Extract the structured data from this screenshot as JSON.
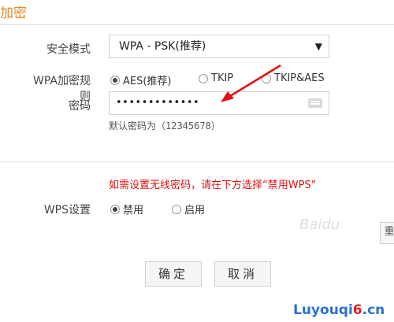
{
  "title": "加密",
  "security_mode": {
    "label": "安全模式",
    "value": "WPA - PSK(推荐)"
  },
  "wpa_rule": {
    "label": "WPA加密规则",
    "options": [
      {
        "label": "AES(推荐)",
        "selected": true
      },
      {
        "label": "TKIP",
        "selected": false
      },
      {
        "label": "TKIP&AES",
        "selected": false
      }
    ]
  },
  "password": {
    "label": "密码",
    "value": "•••••••••••••",
    "hint": "默认密码为（12345678）"
  },
  "warning": "如需设置无线密码，请在下方选择“禁用WPS”",
  "wps": {
    "label": "WPS设置",
    "options": [
      {
        "label": "禁用",
        "selected": true
      },
      {
        "label": "启用",
        "selected": false
      }
    ]
  },
  "side_button": "重",
  "buttons": {
    "ok": "确定",
    "cancel": "取消"
  },
  "watermark": {
    "text1": "Baidu",
    "text2_a": "Luyouqi",
    "text2_b": "6",
    "text2_c": ".cn"
  },
  "colors": {
    "accent": "#e8891e",
    "warning": "#e01010",
    "arrow": "#e01010"
  }
}
